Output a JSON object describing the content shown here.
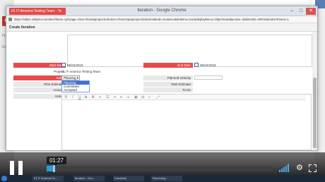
{
  "browser": {
    "tab_label": "01 IT America Testing Team - To",
    "window_title": "Iteration - Google Chrome",
    "url": "https://sdlyt1.sellydev.com/dev/iframe.cgi?page=View.ITeam&projectSelection=ITeamOps&projectSelectionMode=true&moduleMenu=true&displayMenu=Objective&objective=40&itemID=4057&iterationParent=1",
    "dialog_title": "Create Iteration"
  },
  "form": {
    "start_date_label": "Start Date",
    "start_date_value": "05/22/2018",
    "end_date_label": "End Date",
    "end_date_value": "06/22/2018",
    "project_label": "Project",
    "project_value": "01 IT America Testing Team",
    "state_label": "State",
    "state_value": "Planning",
    "state_options": [
      "Planning",
      "Committed",
      "Accepted"
    ],
    "plan_estimate_label": "Plan Estimate",
    "actuals_label": "Actuals",
    "notes_label": "Notes",
    "planned_velocity_label": "Planned Velocity",
    "task_estimate_label": "Task Estimate",
    "to_do_label": "To Do"
  },
  "editor": {
    "toolbar_icons": [
      "bold-icon",
      "italic-icon",
      "underline-icon",
      "strikethrough-icon",
      "font-color-icon",
      "bullet-list-icon",
      "numbered-list-icon",
      "indent-icon",
      "outdent-icon",
      "link-icon",
      "image-icon",
      "table-icon",
      "code-icon",
      "fullscreen-icon"
    ]
  },
  "player": {
    "time": "01:27",
    "progress": 0.03
  },
  "taskbar": {
    "items": [
      "01 IT America Te...",
      "Iteration - Goo...",
      "Camtasia",
      "Recording..."
    ]
  }
}
